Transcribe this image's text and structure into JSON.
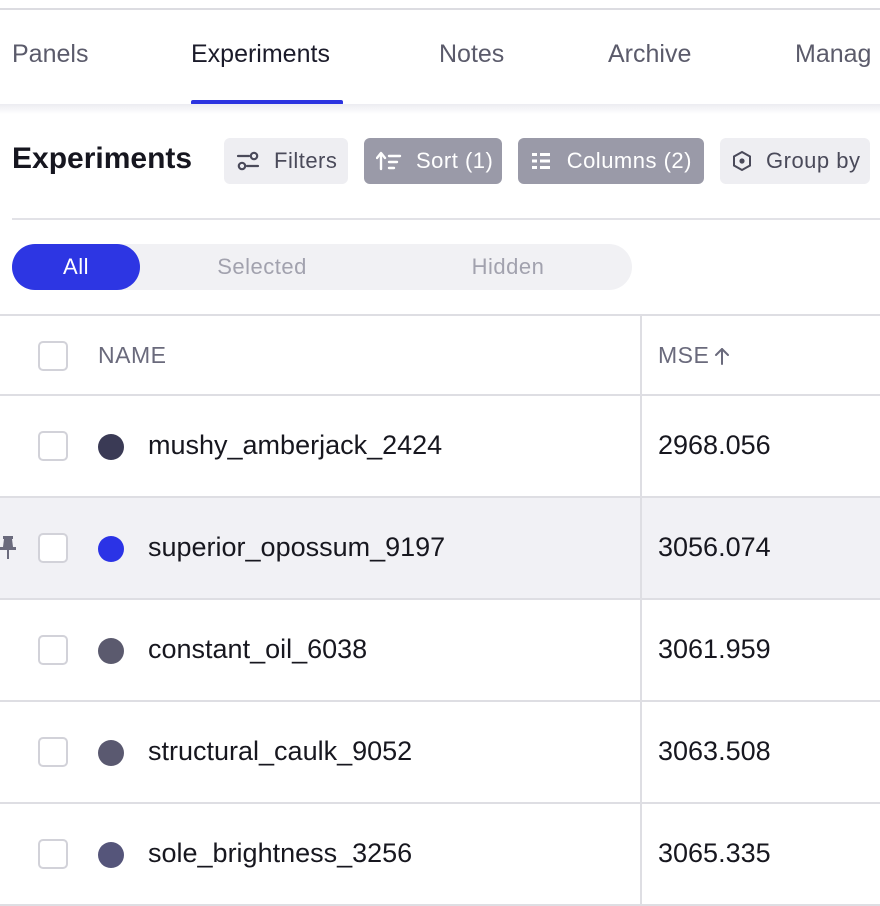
{
  "tabs": [
    {
      "label": "Panels",
      "active": false
    },
    {
      "label": "Experiments",
      "active": true
    },
    {
      "label": "Notes",
      "active": false
    },
    {
      "label": "Archive",
      "active": false
    },
    {
      "label": "Manag",
      "active": false
    }
  ],
  "toolbar": {
    "title": "Experiments",
    "filters_label": "Filters",
    "filters_icon": "sliders-icon",
    "sort_label": "Sort (1)",
    "sort_icon": "sort-icon",
    "columns_label": "Columns (2)",
    "columns_icon": "columns-icon",
    "group_by_label": "Group by",
    "group_by_icon": "hexagon-icon"
  },
  "visibility_filter": {
    "options": [
      "All",
      "Selected",
      "Hidden"
    ],
    "selected": "All"
  },
  "table": {
    "columns": {
      "name": "NAME",
      "mse": "MSE"
    },
    "sort": {
      "column": "MSE",
      "direction": "ascending"
    },
    "rows": [
      {
        "name": "mushy_amberjack_2424",
        "mse": "2968.056",
        "color": "#3a3a55",
        "pinned": false,
        "highlighted": false
      },
      {
        "name": "superior_opossum_9197",
        "mse": "3056.074",
        "color": "#2b33e6",
        "pinned": true,
        "highlighted": true
      },
      {
        "name": "constant_oil_6038",
        "mse": "3061.959",
        "color": "#5b5a6e",
        "pinned": false,
        "highlighted": false
      },
      {
        "name": "structural_caulk_9052",
        "mse": "3063.508",
        "color": "#5a5970",
        "pinned": false,
        "highlighted": false
      },
      {
        "name": "sole_brightness_3256",
        "mse": "3065.335",
        "color": "#55557a",
        "pinned": false,
        "highlighted": false
      }
    ]
  },
  "colors": {
    "accent": "#2c34e0",
    "pin": "#6a6a7c"
  }
}
